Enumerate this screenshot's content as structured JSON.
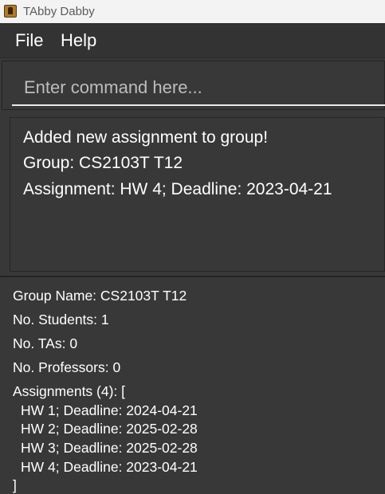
{
  "window": {
    "title": "TAbby Dabby",
    "icon": "app-icon"
  },
  "menu": {
    "file": "File",
    "help": "Help"
  },
  "command": {
    "placeholder": "Enter command here...",
    "value": ""
  },
  "result": {
    "lines": [
      "Added new assignment to group!",
      "Group: CS2103T T12",
      "Assignment: HW 4; Deadline: 2023-04-21"
    ]
  },
  "group_detail": {
    "name_line": "Group Name: CS2103T T12",
    "students_line": "No. Students: 1",
    "tas_line": "No. TAs: 0",
    "professors_line": "No. Professors: 0",
    "assignments_header": "Assignments (4): [",
    "assignments": [
      "HW 1; Deadline: 2024-04-21",
      "HW 2; Deadline: 2025-02-28",
      "HW 3; Deadline: 2025-02-28",
      "HW 4; Deadline: 2023-04-21"
    ],
    "closing": "]"
  }
}
